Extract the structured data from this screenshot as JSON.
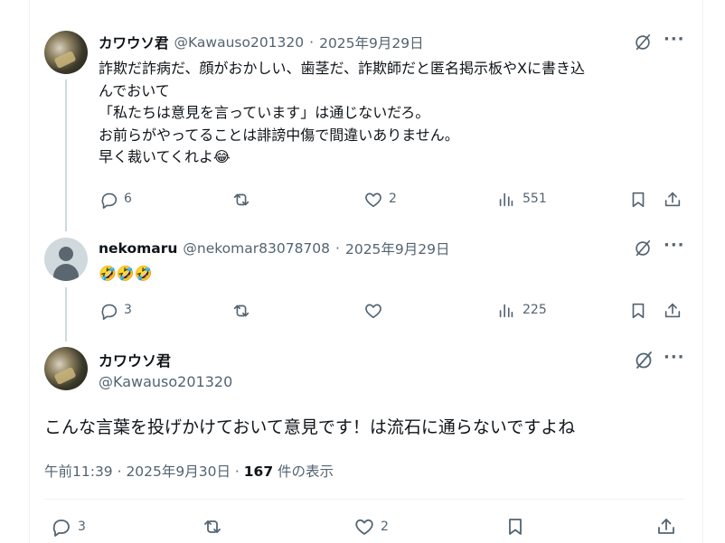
{
  "tweets": [
    {
      "name": "カワウソ君",
      "handle": "@Kawauso201320",
      "sep": "·",
      "date": "2025年9月29日",
      "text": "詐欺だ詐病だ、顔がおかしい、歯茎だ、詐欺師だと匿名掲示板やXに書き込\nんでおいて\n「私たちは意見を言っています」は通じないだろ。\nお前らがやってることは誹謗中傷で間違いありません。\n早く裁いてくれよ😂",
      "replies": "6",
      "likes": "2",
      "views": "551"
    },
    {
      "name": "nekomaru",
      "handle": "@nekomar83078708",
      "sep": "·",
      "date": "2025年9月29日",
      "text": "🤣🤣🤣",
      "replies": "3",
      "views": "225"
    }
  ],
  "main": {
    "name": "カワウソ君",
    "handle": "@Kawauso201320",
    "text": "こんな言葉を投げかけておいて意見です！は流石に通らないですよね",
    "time": "午前11:39 · 2025年9月30日 · ",
    "views_count": "167",
    "views_label": " 件の表示",
    "replies": "3",
    "likes": "2"
  },
  "icons": {
    "grok": "grok-icon",
    "more": "more-icon",
    "reply": "reply-icon",
    "retweet": "retweet-icon",
    "like": "like-icon",
    "views": "views-icon",
    "bookmark": "bookmark-icon",
    "share": "share-icon"
  },
  "more_glyph": "···",
  "colors": {
    "text": "#0f1419",
    "muted": "#536471",
    "line": "#cfd9de"
  }
}
